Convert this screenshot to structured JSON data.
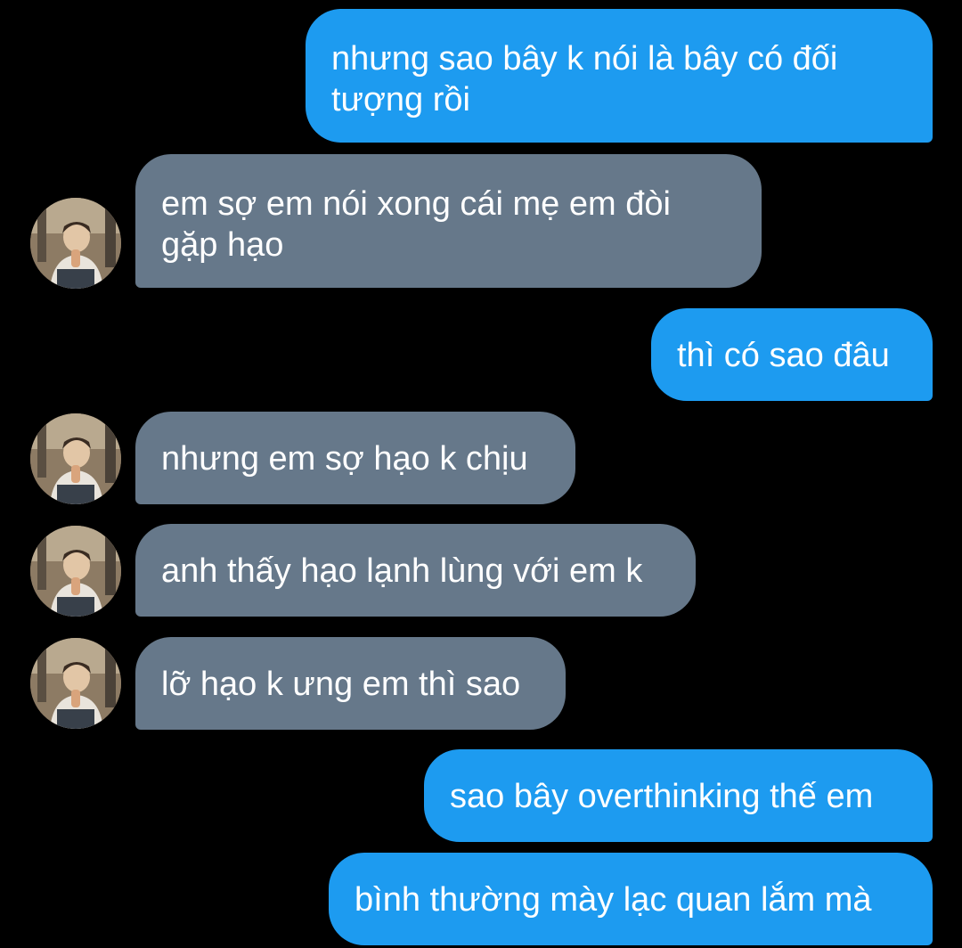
{
  "colors": {
    "background": "#000000",
    "sent_bubble": "#1d9bf0",
    "received_bubble": "#66788a",
    "text": "#ffffff"
  },
  "messages": [
    {
      "direction": "sent",
      "text": "nhưng sao bây k nói là bây có đối tượng rồi"
    },
    {
      "direction": "received",
      "text": "em sợ em nói xong cái mẹ em đòi gặp hạo"
    },
    {
      "direction": "sent",
      "text": "thì có sao đâu"
    },
    {
      "direction": "received",
      "text": "nhưng em sợ hạo k chịu"
    },
    {
      "direction": "received",
      "text": "anh thấy hạo lạnh lùng với em k"
    },
    {
      "direction": "received",
      "text": "lỡ hạo k ưng em thì sao"
    },
    {
      "direction": "sent",
      "text": "sao bây overthinking thế em"
    },
    {
      "direction": "sent",
      "text": "bình thường mày lạc quan lắm mà"
    }
  ],
  "avatar": {
    "icon": "contact-avatar-photo"
  }
}
